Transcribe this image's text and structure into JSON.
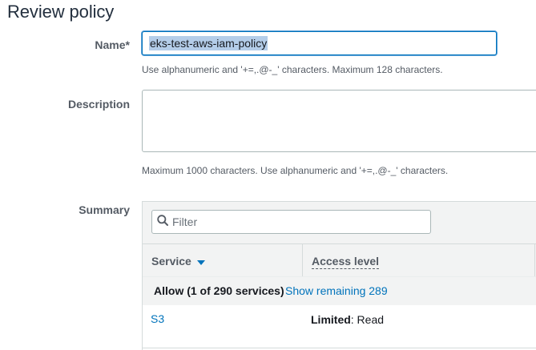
{
  "page": {
    "title": "Review policy"
  },
  "name_field": {
    "label": "Name*",
    "value": "eks-test-aws-iam-policy",
    "hint": "Use alphanumeric and '+=,.@-_' characters. Maximum 128 characters."
  },
  "description_field": {
    "label": "Description",
    "value": "",
    "hint": "Maximum 1000 characters. Use alphanumeric and '+=,.@-_' characters."
  },
  "summary": {
    "label": "Summary",
    "filter_placeholder": "Filter",
    "columns": {
      "service": "Service",
      "access_level": "Access level"
    },
    "allow_row": {
      "text": "Allow (1 of 290 services)",
      "link": "Show remaining 289"
    },
    "rows": [
      {
        "service": "S3",
        "access_prefix": "Limited",
        "access_suffix": ": Read"
      }
    ]
  },
  "colors": {
    "link": "#0073bb",
    "focus_border": "#0073bb",
    "selection": "#b4cde9"
  },
  "icons": {
    "filter": "search-icon",
    "sort": "sort-desc-icon"
  }
}
